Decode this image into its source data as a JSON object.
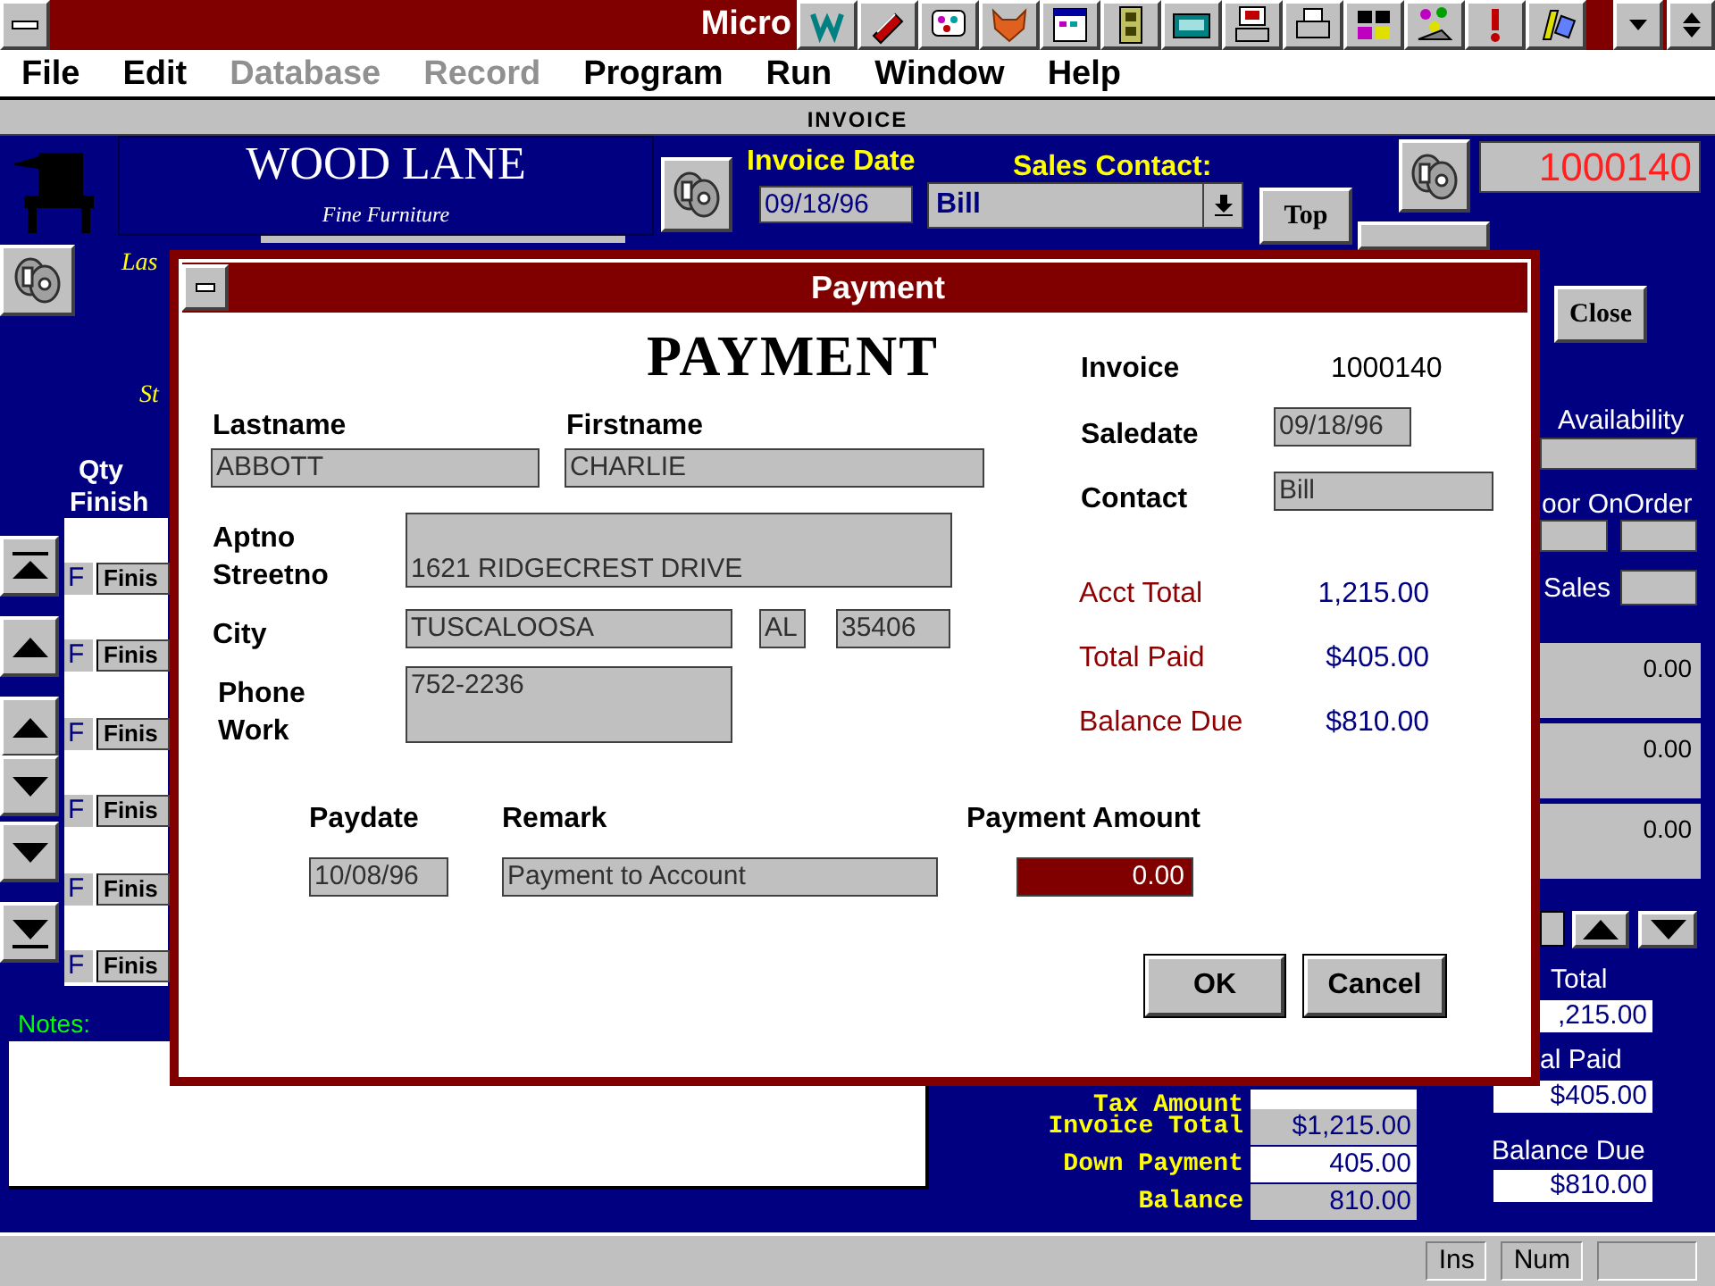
{
  "title_bar": {
    "title": "Micro"
  },
  "menu": [
    {
      "label": "File",
      "disabled": false
    },
    {
      "label": "Edit",
      "disabled": false
    },
    {
      "label": "Database",
      "disabled": true
    },
    {
      "label": "Record",
      "disabled": true
    },
    {
      "label": "Program",
      "disabled": false
    },
    {
      "label": "Run",
      "disabled": false
    },
    {
      "label": "Window",
      "disabled": false
    },
    {
      "label": "Help",
      "disabled": false
    }
  ],
  "invoice_form": {
    "header": "INVOICE",
    "company": "WOOD LANE",
    "tagline": "Fine Furniture",
    "invoice_date_label": "Invoice Date",
    "invoice_date": "09/18/96",
    "sales_contact_label": "Sales Contact:",
    "sales_contact": "Bill",
    "top_button": "Top",
    "invoice_number": "1000140",
    "close_button": "Close",
    "lastname_label_partial": "Las",
    "street_label_partial": "St",
    "qty_label": "Qty",
    "finish_label": "Finish",
    "rows": [
      {
        "flag": "F",
        "finish": "Finis"
      },
      {
        "flag": "F",
        "finish": "Finis"
      },
      {
        "flag": "F",
        "finish": "Finis"
      },
      {
        "flag": "F",
        "finish": "Finis"
      },
      {
        "flag": "F",
        "finish": "Finis"
      },
      {
        "flag": "F",
        "finish": "Finis"
      }
    ],
    "notes_label": "Notes:",
    "availability_label": "Availability",
    "onorder_label": "oor OnOrder",
    "sales_label": "Sales",
    "line_amounts": [
      "0.00",
      "0.00",
      "0.00"
    ],
    "tax_amount_label": "Tax Amount",
    "invoice_total_label": "Invoice Total",
    "invoice_total": "$1,215.00",
    "down_payment_label": "Down Payment",
    "down_payment": "405.00",
    "balance_label": "Balance",
    "balance": "810.00",
    "acct_total_label_partial": "Total",
    "acct_total_partial": ",215.00",
    "total_paid_label_partial": "al Paid",
    "total_paid": "$405.00",
    "balance_due_label": "Balance Due",
    "balance_due": "$810.00"
  },
  "dialog": {
    "title": "Payment",
    "heading": "PAYMENT",
    "lastname_label": "Lastname",
    "lastname": "ABBOTT",
    "firstname_label": "Firstname",
    "firstname": "CHARLIE",
    "aptno_label": "Aptno",
    "streetno_label": "Streetno",
    "street": "1621 RIDGECREST DRIVE",
    "city_label": "City",
    "city": "TUSCALOOSA",
    "state": "AL",
    "zip": "35406",
    "phone_label": "Phone",
    "work_label": "Work",
    "phone": "752-2236",
    "invoice_label": "Invoice",
    "invoice": "1000140",
    "saledate_label": "Saledate",
    "saledate": "09/18/96",
    "contact_label": "Contact",
    "contact": "Bill",
    "acct_total_label": "Acct Total",
    "acct_total": "1,215.00",
    "total_paid_label": "Total Paid",
    "total_paid": "$405.00",
    "balance_due_label": "Balance Due",
    "balance_due": "$810.00",
    "paydate_label": "Paydate",
    "remark_label": "Remark",
    "payment_amount_label": "Payment Amount",
    "paydate": "10/08/96",
    "remark": "Payment to Account",
    "payment_amount": "0.00",
    "buttons": [
      "OK",
      "Cancel"
    ]
  },
  "status_bar": [
    "Ins",
    "Num"
  ]
}
